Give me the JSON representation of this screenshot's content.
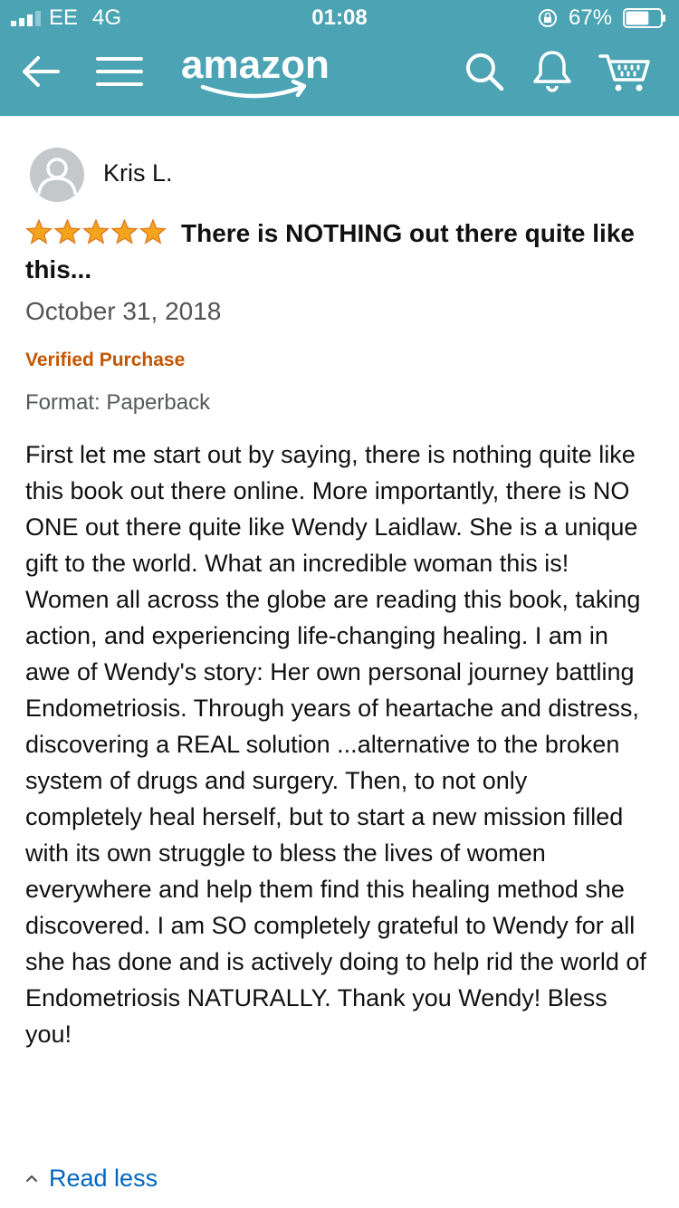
{
  "status_bar": {
    "carrier": "EE",
    "network": "4G",
    "time": "01:08",
    "battery": "67%",
    "battery_level": 0.67,
    "icons": [
      "signal-bars-icon",
      "rotation-lock-icon",
      "battery-icon"
    ]
  },
  "nav": {
    "logo_text": "amazon",
    "icons": [
      "back-arrow-icon",
      "hamburger-menu-icon",
      "search-icon",
      "bell-icon",
      "cart-icon"
    ]
  },
  "review": {
    "reviewer": "Kris L.",
    "rating": 5,
    "rating_max": 5,
    "title": "There is NOTHING out there quite like this...",
    "date": "October 31, 2018",
    "verified": "Verified Purchase",
    "format": "Format: Paperback",
    "body": "First let me start out by saying, there is nothing quite like this book out there online. More importantly, there is NO ONE out there quite like Wendy Laidlaw. She is a unique gift to the world. What an incredible woman this is! Women all across the globe are reading this book, taking action, and experiencing life-changing healing. I am in awe of Wendy's story: Her own personal journey battling Endometriosis. Through years of heartache and distress, discovering a REAL solution ...alternative to the broken system of drugs and surgery. Then, to not only completely heal herself, but to start a new mission filled with its own struggle to bless the lives of women everywhere and help them find this healing method she discovered. I am SO completely grateful to Wendy for all she has done and is actively doing to help rid the world of Endometriosis NATURALLY. Thank you Wendy! Bless you!",
    "read_less": "Read less"
  },
  "colors": {
    "header_bg": "#4ba3b3",
    "star": "#f4a41c",
    "verified": "#c45500",
    "link": "#0066c0",
    "smile": "#ffffff"
  }
}
